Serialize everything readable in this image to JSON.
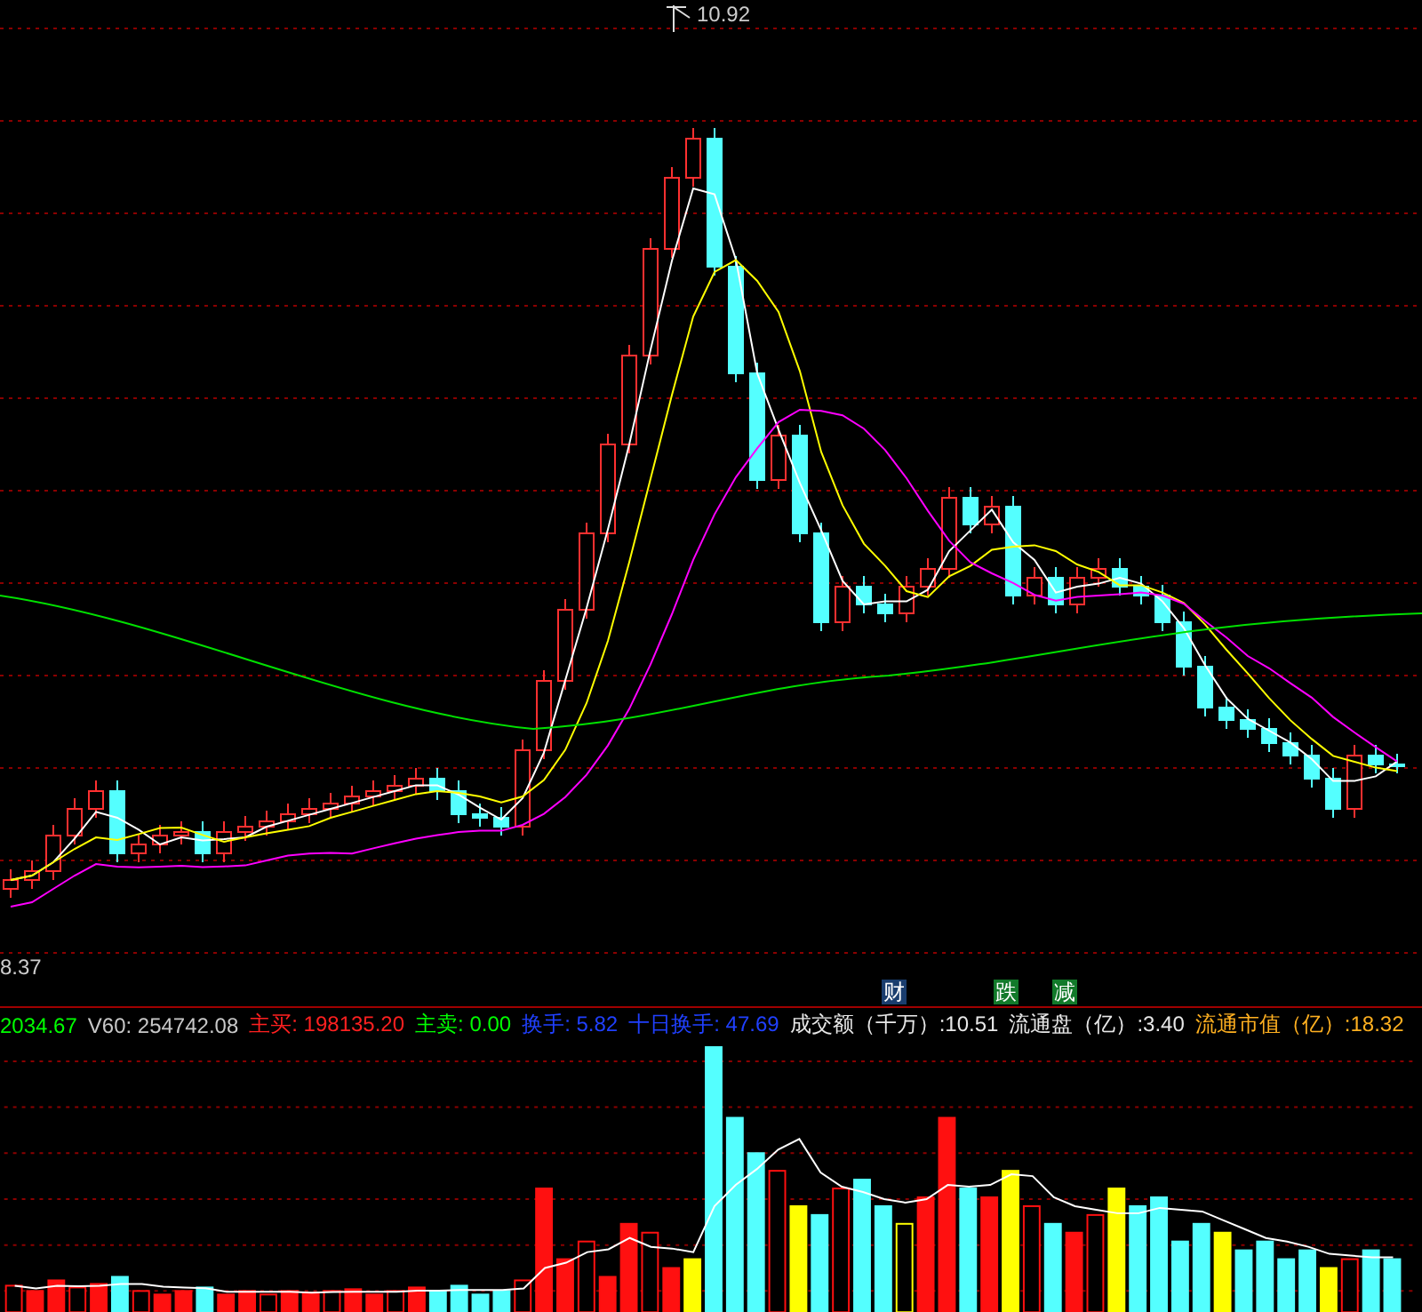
{
  "price_chart": {
    "high_label": "10.92",
    "low_label": "8.37",
    "markers": [
      {
        "text": "财",
        "color": "#1a3d6e"
      },
      {
        "text": "跌",
        "color": "#127a2a"
      },
      {
        "text": "减",
        "color": "#127a2a"
      }
    ]
  },
  "indicator_bar": {
    "items": [
      {
        "text": "2034.67",
        "color": "#00ff00"
      },
      {
        "text": "V60: 254742.08",
        "color": "#c8c8c8"
      },
      {
        "text": "主买: 198135.20",
        "color": "#ff2020"
      },
      {
        "text": "主卖: 0.00",
        "color": "#00ff00"
      },
      {
        "text": "换手: 5.82",
        "color": "#2040ff"
      },
      {
        "text": "十日换手: 47.69",
        "color": "#2040ff"
      },
      {
        "text": "成交额（千万）:10.51",
        "color": "#e8e8e8"
      },
      {
        "text": "流通盘（亿）:3.40",
        "color": "#e8e8e8"
      },
      {
        "text": "流通市值（亿）:18.32",
        "color": "#ffb020"
      }
    ]
  }
}
